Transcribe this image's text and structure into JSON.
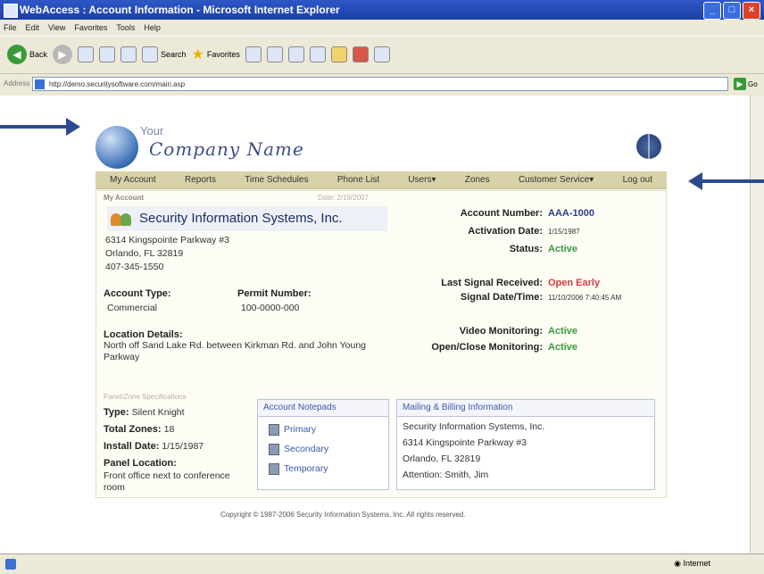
{
  "browser": {
    "title": "WebAccess : Account Information - Microsoft Internet Explorer",
    "menu": [
      "File",
      "Edit",
      "View",
      "Favorites",
      "Tools",
      "Help"
    ],
    "toolbar": {
      "back_label": "Back",
      "search_label": "Search",
      "favorites_label": "Favorites"
    },
    "address_label": "Address",
    "url": "http://demo.securitysoftware.com/main.asp",
    "go_label": "Go",
    "status_zone": "Internet"
  },
  "header": {
    "logo_your": "Your",
    "logo_company": "Company Name"
  },
  "nav": [
    "My Account",
    "Reports",
    "Time Schedules",
    "Phone List",
    "Users▾",
    "Zones",
    "Customer Service▾",
    "Log out"
  ],
  "account": {
    "section_label": "My Account",
    "date_label": "Date: 2/19/2007",
    "company_name": "Security Information Systems, Inc.",
    "address": [
      "6314 Kingspointe Parkway #3",
      "Orlando, FL 32819",
      "407-345-1550"
    ],
    "account_type_label": "Account Type:",
    "account_type": "Commercial",
    "permit_label": "Permit Number:",
    "permit": "100-0000-000",
    "location_label": "Location Details:",
    "location": "North off Sand Lake Rd. between Kirkman Rd. and John Young Parkway",
    "account_number_label": "Account Number:",
    "account_number": "AAA-1000",
    "activation_label": "Activation Date:",
    "activation": "1/15/1987",
    "status_label": "Status:",
    "status": "Active",
    "last_signal_label": "Last Signal Received:",
    "last_signal": "Open Early",
    "signal_dt_label": "Signal Date/Time:",
    "signal_dt": "11/10/2006 7:40:45 AM",
    "video_label": "Video Monitoring:",
    "video": "Active",
    "openclose_label": "Open/Close Monitoring:",
    "openclose": "Active"
  },
  "panel": {
    "section_label": "Panel/Zone Specifications",
    "type_label": "Type:",
    "type": "Silent Knight",
    "zones_label": "Total Zones:",
    "zones": "18",
    "install_label": "Install Date:",
    "install": "1/15/1987",
    "location_label": "Panel Location:",
    "location": "Front office next to conference room"
  },
  "notepads": {
    "title": "Account Notepads",
    "items": [
      "Primary",
      "Secondary",
      "Temporary"
    ]
  },
  "mailing": {
    "title": "Mailing & Billing Information",
    "lines": [
      "Security Information Systems, Inc.",
      "6314 Kingspointe Parkway #3",
      "Orlando, FL 32819",
      "Attention: Smith, Jim"
    ]
  },
  "footer": {
    "copyright": "Copyright © 1987-2006 Security Information Systems, Inc. All rights reserved."
  }
}
